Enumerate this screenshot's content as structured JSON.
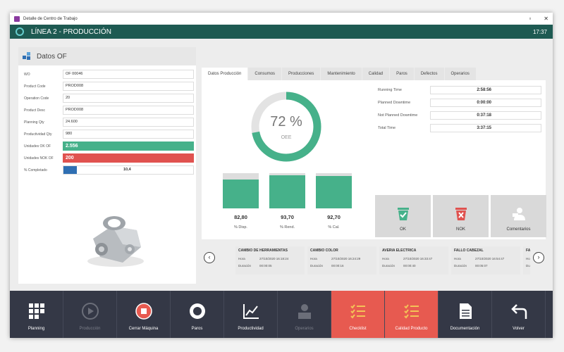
{
  "window": {
    "title": "Detalle de Centro de Trabajo",
    "minimize": "▫",
    "close": "✕"
  },
  "header": {
    "title": "LÍNEA 2 - PRODUCCIÓN",
    "time": "17:37"
  },
  "datos_of": {
    "title": "Datos OF",
    "fields": [
      {
        "label": "WO",
        "value": "OF 00046"
      },
      {
        "label": "Product Code",
        "value": "PROD008"
      },
      {
        "label": "Operation Code",
        "value": "20"
      },
      {
        "label": "Product Desc",
        "value": "PROD008"
      },
      {
        "label": "Planning Qty",
        "value": "24.600"
      },
      {
        "label": "Productividad Qty",
        "value": "980"
      },
      {
        "label": "Unidades OK OF",
        "value": "2.556"
      },
      {
        "label": "Unidades NOK OF",
        "value": "200"
      },
      {
        "label": "% Completado",
        "value": "10,4"
      }
    ],
    "progress_fraction": 0.104
  },
  "tabs": [
    "Datos Producción",
    "Consumos",
    "Producciones",
    "Mantenimiento",
    "Calidad",
    "Paros",
    "Defectos",
    "Operarios"
  ],
  "oee": {
    "percent": "72 %",
    "label": "OEE",
    "fraction": 0.72
  },
  "kpis": [
    {
      "value": "82,80",
      "label": "% Disp.",
      "fraction": 0.828
    },
    {
      "value": "93,70",
      "label": "% Rend.",
      "fraction": 0.937
    },
    {
      "value": "92,70",
      "label": "% Cal.",
      "fraction": 0.927
    }
  ],
  "times": [
    {
      "label": "Running Time",
      "value": "2:58:56"
    },
    {
      "label": "Planned Downtime",
      "value": "0:00:00"
    },
    {
      "label": "Not Planned Downtime",
      "value": "0:37:18"
    },
    {
      "label": "Total Time",
      "value": "3:37:15"
    }
  ],
  "actions": [
    {
      "label": "OK",
      "color": "#46b18a"
    },
    {
      "label": "NOK",
      "color": "#e0524f"
    },
    {
      "label": "Comentarios",
      "color": "#ffffff"
    }
  ],
  "events": [
    {
      "title": "CAMBIO DE HERRAMIENTAS",
      "hora_label": "Hora",
      "hora": "27/10/2020 16:18:24",
      "dur_label": "Duración",
      "dur": "00:00:05"
    },
    {
      "title": "CAMBIO COLOR",
      "hora_label": "Hora",
      "hora": "27/10/2020 16:24:29",
      "dur_label": "Duración",
      "dur": "00:00:16"
    },
    {
      "title": "AVERIA ELECTRICA",
      "hora_label": "Hora",
      "hora": "27/10/2020 16:33:47",
      "dur_label": "Duración",
      "dur": "00:00:40"
    },
    {
      "title": "FALLO CABEZAL",
      "hora_label": "Hora",
      "hora": "27/10/2020 16:54:47",
      "dur_label": "Duración",
      "dur": "00:05:07"
    },
    {
      "title": "FALL",
      "hora_label": "Ho",
      "hora": "",
      "dur_label": "Du",
      "dur": ""
    }
  ],
  "toolbar": [
    {
      "label": "Planning",
      "state": "normal"
    },
    {
      "label": "Producción",
      "state": "disabled"
    },
    {
      "label": "Cerrar Máquina",
      "state": "normal"
    },
    {
      "label": "Paros",
      "state": "normal"
    },
    {
      "label": "Productividad",
      "state": "normal"
    },
    {
      "label": "Operarios",
      "state": "disabled"
    },
    {
      "label": "Checklist",
      "state": "red"
    },
    {
      "label": "Calidad Producto",
      "state": "red"
    },
    {
      "label": "Documentación",
      "state": "normal"
    },
    {
      "label": "Volver",
      "state": "normal"
    }
  ],
  "colors": {
    "header": "#1e5a52",
    "green": "#46b18a",
    "red": "#e0524f",
    "blue": "#2f6fb3",
    "toolbar": "#343846"
  }
}
